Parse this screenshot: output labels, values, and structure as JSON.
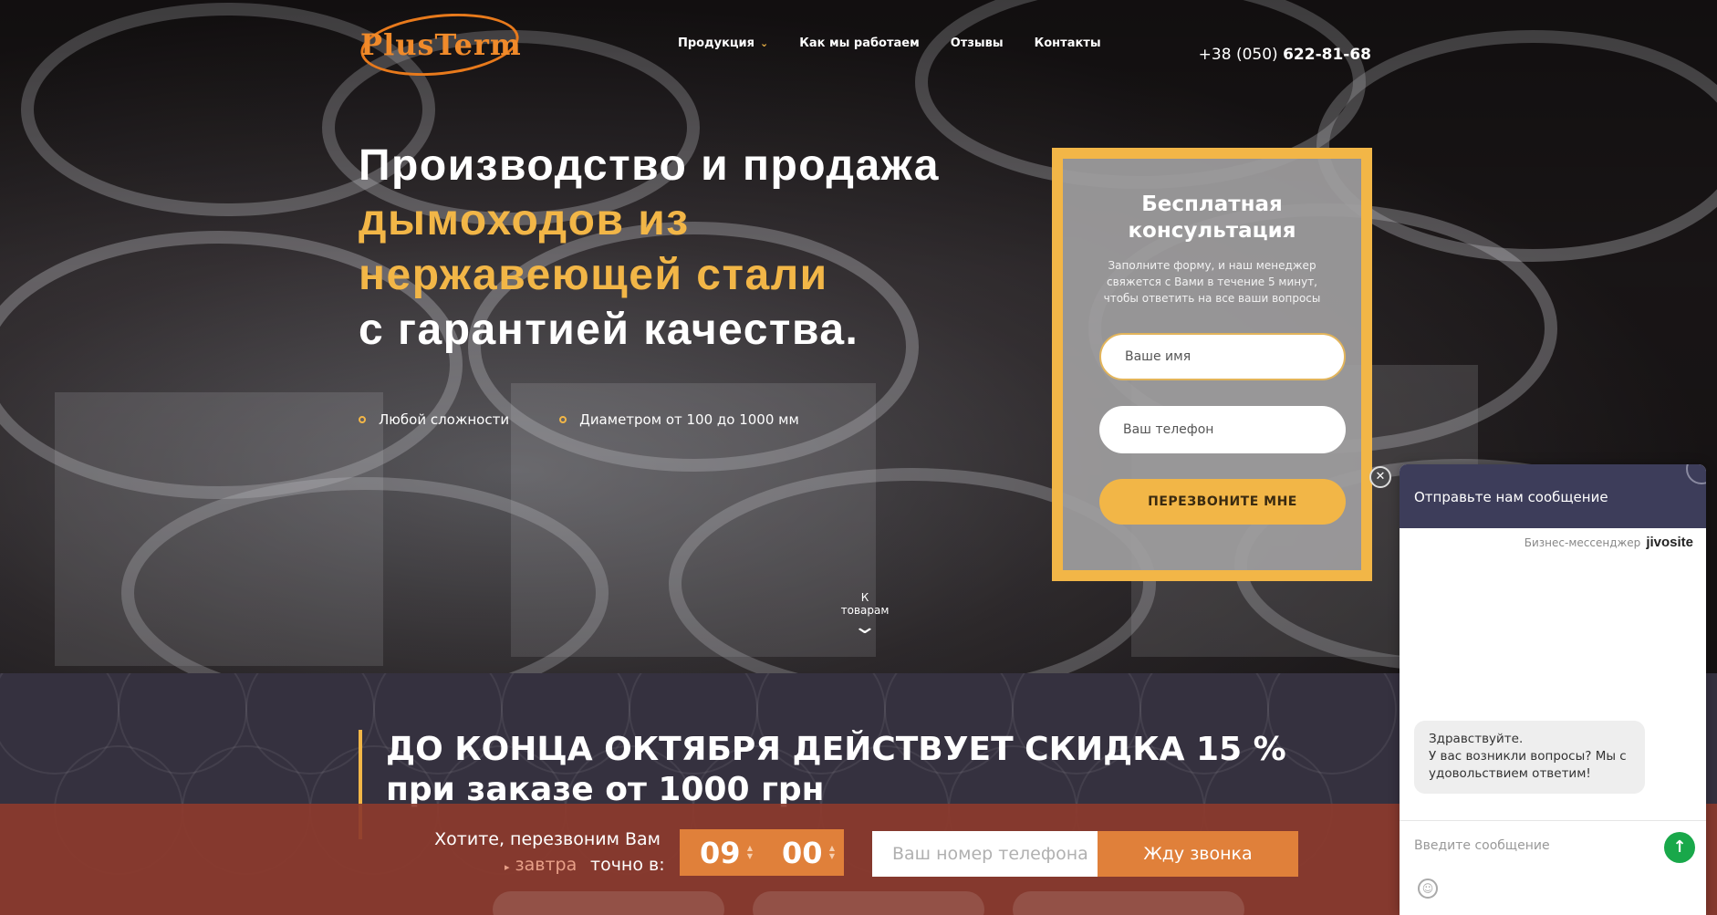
{
  "header": {
    "logo_text": "PlusTerm",
    "nav": [
      {
        "label": "Продукция"
      },
      {
        "label": "Как мы работаем"
      },
      {
        "label": "Отзывы"
      },
      {
        "label": "Контакты"
      }
    ],
    "phone_prefix": "+38 (050)",
    "phone_number": "622-81-68"
  },
  "hero": {
    "line1": "Производство и продажа",
    "line2": "дымоходов из",
    "line3": "нержавеющей стали",
    "line4": "с гарантией качества.",
    "features": [
      "Любой сложности",
      "Диаметром от 100 до 1000 мм"
    ],
    "scroll_label": "К товарам"
  },
  "consult_form": {
    "title_line1": "Бесплатная",
    "title_line2": "консультация",
    "subtitle": "Заполните форму, и наш менеджер свяжется с Вами в течение 5 минут, чтобы ответить на все ваши вопросы",
    "name_placeholder": "Ваше имя",
    "phone_placeholder": "Ваш телефон",
    "submit_label": "ПЕРЕЗВОНИТЕ МНЕ"
  },
  "promo": {
    "title": "ДО КОНЦА ОКТЯБРЯ ДЕЙСТВУЕТ СКИДКА 15 % при заказе от 1000 грн"
  },
  "callback_bar": {
    "question": "Хотите, перезвоним Вам",
    "day": "завтра",
    "exact_time": "точно в:",
    "hour": "09",
    "minute": "00",
    "phone_placeholder": "Ваш номер телефона",
    "button_label": "Жду звонка"
  },
  "chat": {
    "close_glyph": "✕",
    "header_title": "Отправьте нам сообщение",
    "brand_caption": "Бизнес-мессенджер",
    "brand_name": "jivosite",
    "greeting_line1": "Здравствуйте.",
    "greeting_line2": "У вас возникли вопросы? Мы с удовольствием ответим!",
    "input_placeholder": "Введите сообщение"
  },
  "colors": {
    "accent": "#f2b647",
    "callback_bg": "#8c3a2d",
    "callback_accent": "#e0803a",
    "chat_header": "#3d3d5a",
    "send_button": "#19a84a"
  }
}
